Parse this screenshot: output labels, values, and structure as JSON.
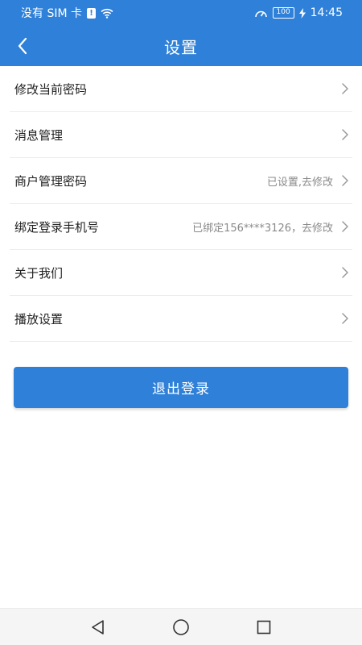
{
  "status_bar": {
    "carrier": "没有 SIM 卡",
    "battery": "100",
    "time": "14:45",
    "icons": [
      "sim-alert-icon",
      "wifi-icon",
      "speed-icon",
      "battery-icon",
      "charging-icon"
    ]
  },
  "header": {
    "title": "设置",
    "back_icon": "chevron-left-icon"
  },
  "settings": {
    "items": [
      {
        "label": "修改当前密码",
        "value": ""
      },
      {
        "label": "消息管理",
        "value": ""
      },
      {
        "label": "商户管理密码",
        "value": "已设置,去修改"
      },
      {
        "label": "绑定登录手机号",
        "value": "已绑定156****3126，去修改"
      },
      {
        "label": "关于我们",
        "value": ""
      },
      {
        "label": "播放设置",
        "value": ""
      }
    ]
  },
  "logout": {
    "label": "退出登录"
  },
  "nav": {
    "icons": [
      "back-triangle-icon",
      "home-circle-icon",
      "recents-square-icon"
    ]
  },
  "colors": {
    "primary": "#2f80d8",
    "text": "#222222",
    "secondary_text": "#8a8a8a",
    "divider": "#ededed"
  }
}
